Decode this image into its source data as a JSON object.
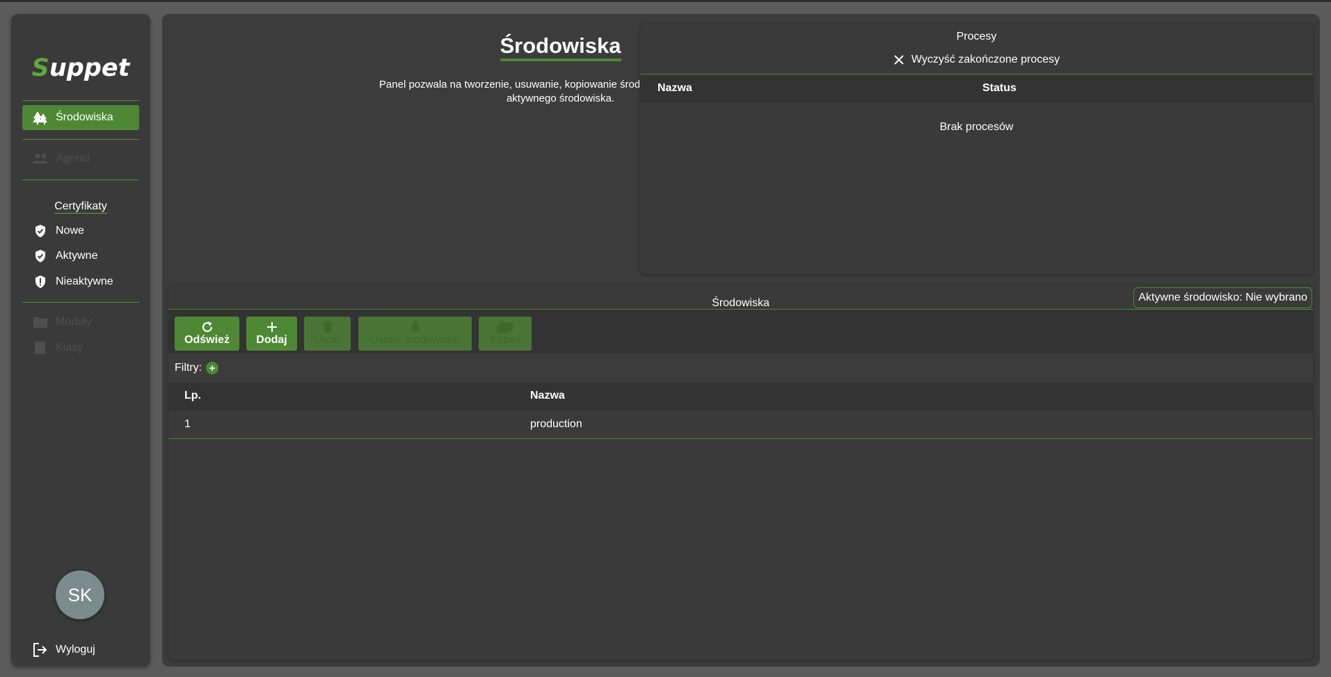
{
  "app": {
    "logo_first": "S",
    "logo_rest": "uppet"
  },
  "sidebar": {
    "items": [
      {
        "label": "Środowiska",
        "active": true
      },
      {
        "label": "Agenci",
        "disabled": true
      }
    ],
    "certificates": {
      "title": "Certyfikaty",
      "items": [
        {
          "label": "Nowe"
        },
        {
          "label": "Aktywne"
        },
        {
          "label": "Nieaktywne"
        }
      ]
    },
    "bottom_items": [
      {
        "label": "Moduły",
        "disabled": true
      },
      {
        "label": "Klasy",
        "disabled": true
      }
    ],
    "avatar_initials": "SK",
    "logout_label": "Wyloguj"
  },
  "header": {
    "title": "Środowiska",
    "description": "Panel pozwala na tworzenie, usuwanie, kopiowanie środowisk oraz ustawianie aktywnego środowiska."
  },
  "processes": {
    "title": "Procesy",
    "clear_label": "Wyczyść zakończone procesy",
    "columns": [
      "Nazwa",
      "Status"
    ],
    "empty_label": "Brak procesów"
  },
  "environments": {
    "title": "Środowiska",
    "active_label": "Aktywne środowisko: Nie wybrano",
    "buttons": {
      "refresh": "Odśwież",
      "add": "Dodaj",
      "delete": "Usuń",
      "set_env": "Ustaw środowisko",
      "copy": "Kopiuj"
    },
    "filters_label": "Filtry:",
    "columns": [
      "Lp.",
      "Nazwa"
    ],
    "rows": [
      {
        "lp": "1",
        "name": "production"
      }
    ]
  },
  "colors": {
    "accent": "#4e8834",
    "logo_accent": "#5fa83c",
    "background": "#5b5b5b",
    "panel": "#3a3a3a"
  }
}
